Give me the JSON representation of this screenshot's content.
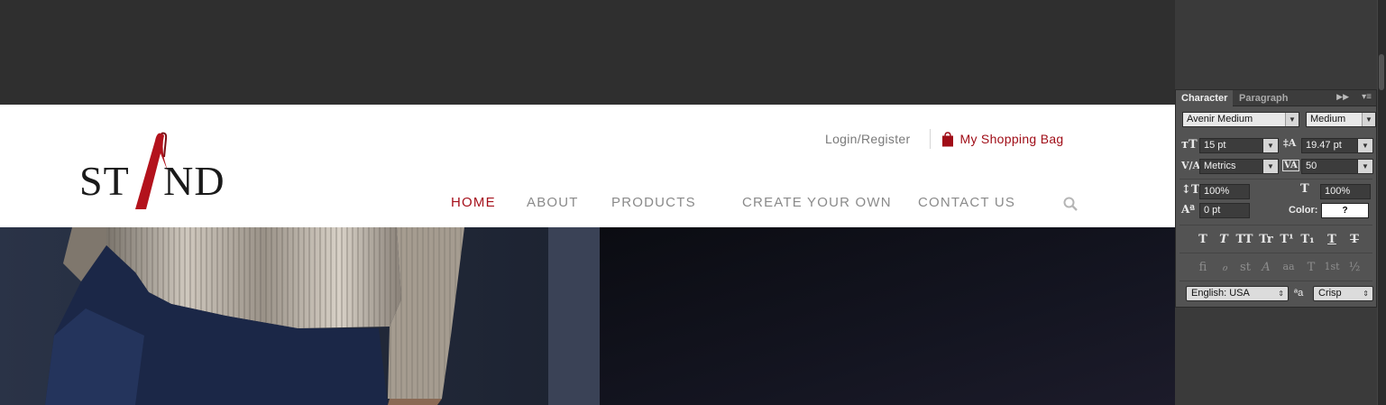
{
  "site": {
    "logo_text": "STAND",
    "login_label": "Login/Register",
    "bag_label": "My Shopping Bag",
    "nav": [
      {
        "label": "HOME",
        "active": true
      },
      {
        "label": "ABOUT",
        "active": false
      },
      {
        "label": "PRODUCTS",
        "active": false
      },
      {
        "label": "CREATE YOUR OWN",
        "active": false
      },
      {
        "label": "CONTACT US",
        "active": false
      }
    ],
    "accent_color": "#a50f1a"
  },
  "character_panel": {
    "tabs": [
      "Character",
      "Paragraph"
    ],
    "font_family": "Avenir Medium",
    "font_style": "Medium",
    "font_size": "15 pt",
    "leading": "19.47 pt",
    "kerning": "Metrics",
    "tracking": "50",
    "vertical_scale": "100%",
    "horizontal_scale": "100%",
    "baseline_shift": "0 pt",
    "color_label": "Color:",
    "color_value": "?",
    "language": "English: USA",
    "antialias_label": "a",
    "antialias": "Crisp",
    "style_buttons": [
      "T",
      "T",
      "TT",
      "Tr",
      "T¹",
      "T₁",
      "T",
      "T"
    ],
    "opentype_buttons": [
      "fi",
      "ℴ",
      "st",
      "A",
      "aa",
      "T",
      "1st",
      "½"
    ]
  }
}
